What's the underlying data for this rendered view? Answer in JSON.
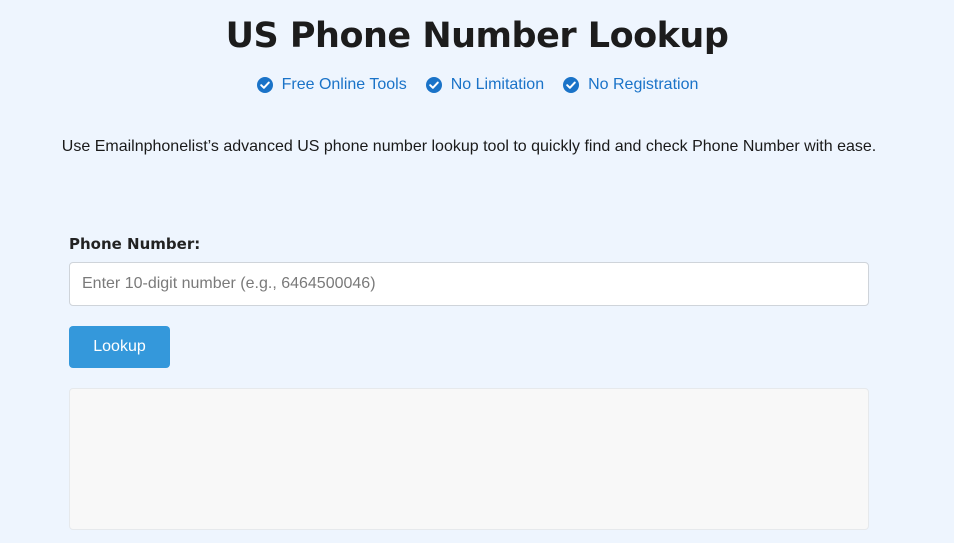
{
  "header": {
    "title": "US Phone Number Lookup",
    "features": [
      {
        "label": "Free Online Tools",
        "icon": "check-circle-icon"
      },
      {
        "label": "No Limitation",
        "icon": "check-circle-icon"
      },
      {
        "label": "No Registration",
        "icon": "check-circle-icon"
      }
    ]
  },
  "intro": "Use Emailnphonelist’s advanced US phone number lookup tool to quickly find and check Phone Number with ease.",
  "form": {
    "label": "Phone Number:",
    "input_value": "",
    "input_placeholder": "Enter 10-digit number (e.g., 6464500046)",
    "button_label": "Lookup"
  },
  "result": {
    "text": ""
  },
  "colors": {
    "background": "#eef5fe",
    "accent": "#3498db",
    "feature_text": "#1a73c8",
    "check_icon": "#1a73c8",
    "result_bg": "#f8f8f8"
  }
}
